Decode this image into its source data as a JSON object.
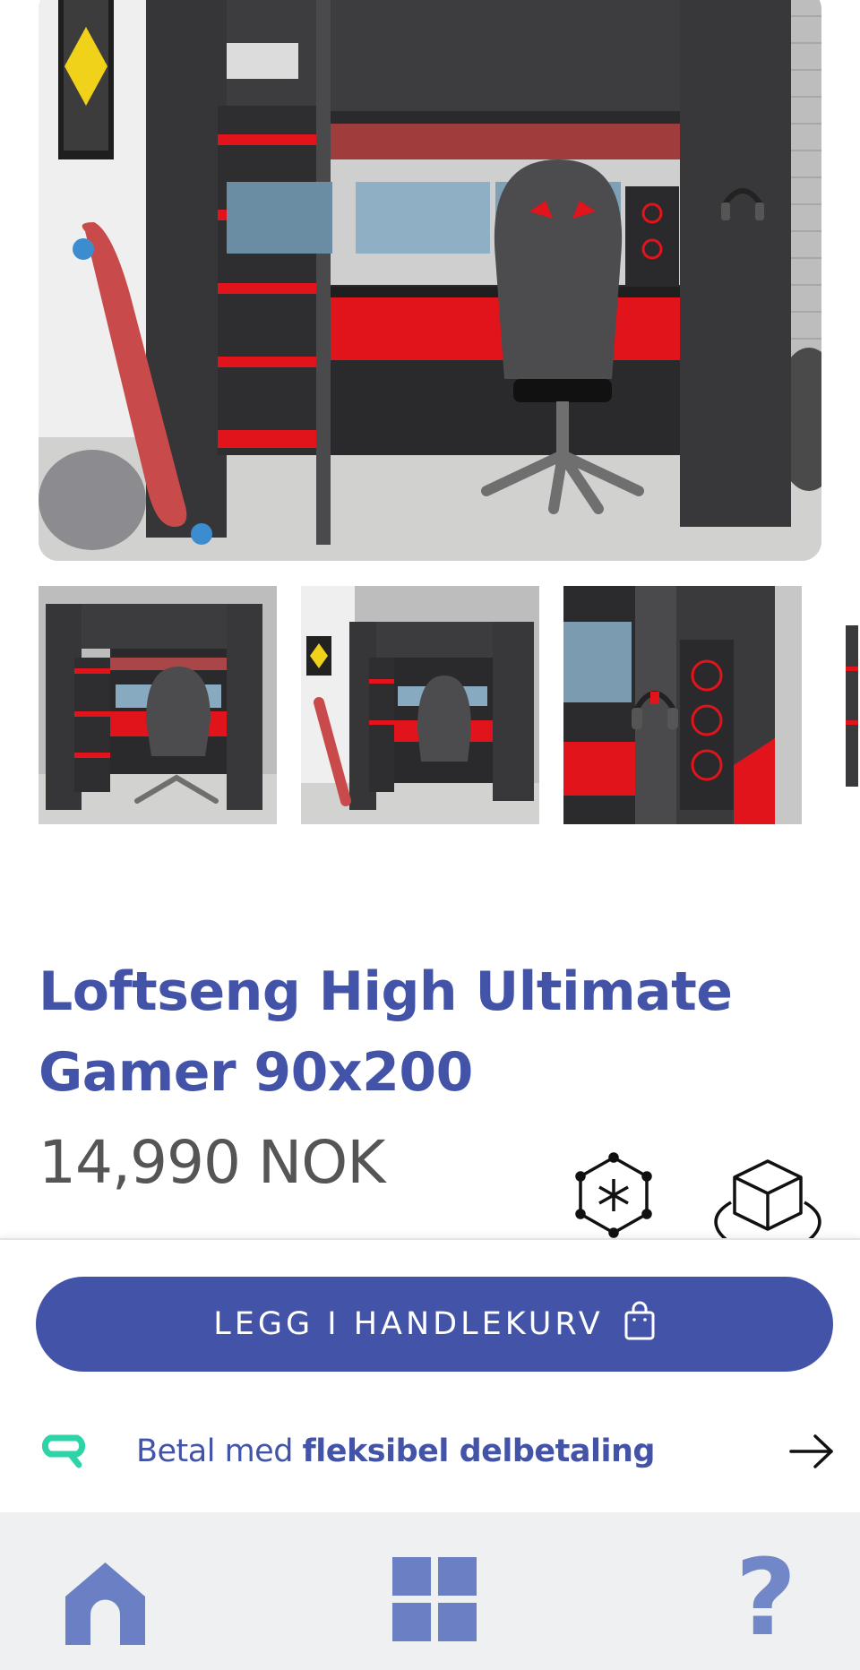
{
  "gallery": {
    "main_image_alt": "",
    "thumbnail_count_visible": 3,
    "colors": {
      "frame_gray": "#3a3a3c",
      "accent_red": "#e0141a",
      "brick": "#b8b8b8",
      "floor": "#d3d3d1"
    }
  },
  "product": {
    "title": "Loftseng High Ultimate Gamer 90x200",
    "price": "14,990 NOK"
  },
  "icons": {
    "ar_view": "ar-view-icon",
    "view_3d": "3d-view-icon",
    "cart": "shopping-bag-icon",
    "installment_logo": "installment-logo-icon",
    "arrow": "arrow-right-icon",
    "home": "home-icon",
    "categories": "categories-grid-icon",
    "help": "help-icon"
  },
  "cart_button": {
    "label": "LEGG I HANDLEKURV"
  },
  "installment": {
    "prefix": "Betal med ",
    "highlight": "fleksibel delbetaling"
  },
  "bottom_nav": {
    "help_glyph": "?"
  },
  "colors": {
    "brand": "#4353a8",
    "nav_icon": "#6b80c4",
    "nav_bg": "#eff0f1",
    "price_text": "#555555",
    "installment_logo": "#2fd3a8"
  }
}
